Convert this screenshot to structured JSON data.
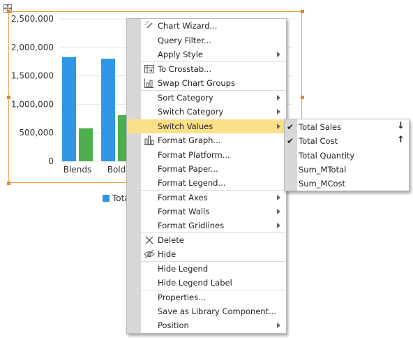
{
  "chart_data": {
    "type": "bar",
    "categories": [
      "Blends",
      "Bold"
    ],
    "series": [
      {
        "name": "Total Sales",
        "values": [
          1830000,
          1800000
        ],
        "color": "#2f96e8"
      },
      {
        "name": "Total Cost",
        "values": [
          580000,
          810000
        ],
        "color": "#4caf50"
      }
    ],
    "ylim": [
      0,
      2500000
    ],
    "yticks": [
      "2,500,000",
      "2,000,000",
      "1,500,000",
      "1,000,000",
      "500,000",
      "0"
    ],
    "grid": true
  },
  "legend": {
    "visible_text": "Tota",
    "color": "#2f96e8"
  },
  "context_menu": {
    "items": [
      {
        "label": "Chart Wizard...",
        "icon": "chart-wizard-icon",
        "submenu": false
      },
      {
        "label": "Query Filter...",
        "icon": "",
        "submenu": false
      },
      {
        "label": "Apply Style",
        "icon": "",
        "submenu": true
      },
      {
        "label": "To Crosstab...",
        "icon": "crosstab-icon",
        "submenu": false
      },
      {
        "label": "Swap Chart Groups",
        "icon": "swap-groups-icon",
        "submenu": false
      },
      {
        "label": "Sort Category",
        "icon": "",
        "submenu": true
      },
      {
        "label": "Switch Category",
        "icon": "",
        "submenu": true
      },
      {
        "label": "Switch Values",
        "icon": "",
        "submenu": true,
        "highlighted": true
      },
      {
        "label": "Format Graph...",
        "icon": "format-graph-icon",
        "submenu": false
      },
      {
        "label": "Format Platform...",
        "icon": "",
        "submenu": false
      },
      {
        "label": "Format Paper...",
        "icon": "",
        "submenu": false
      },
      {
        "label": "Format Legend...",
        "icon": "",
        "submenu": false
      },
      {
        "label": "Format Axes",
        "icon": "",
        "submenu": true
      },
      {
        "label": "Format Walls",
        "icon": "",
        "submenu": true
      },
      {
        "label": "Format Gridlines",
        "icon": "",
        "submenu": true
      },
      {
        "label": "Delete",
        "icon": "delete-icon",
        "submenu": false
      },
      {
        "label": "Hide",
        "icon": "hide-icon",
        "submenu": false
      },
      {
        "label": "Hide Legend",
        "icon": "",
        "submenu": false
      },
      {
        "label": "Hide Legend Label",
        "icon": "",
        "submenu": false
      },
      {
        "label": "Properties...",
        "icon": "",
        "submenu": false
      },
      {
        "label": "Save as Library Component...",
        "icon": "",
        "submenu": false
      },
      {
        "label": "Position",
        "icon": "",
        "submenu": true
      }
    ]
  },
  "submenu": {
    "items": [
      {
        "label": "Total Sales",
        "checked": true,
        "sort": "↓"
      },
      {
        "label": "Total Cost",
        "checked": true,
        "sort": "↑"
      },
      {
        "label": "Total Quantity",
        "checked": false,
        "sort": ""
      },
      {
        "label": "Sum_MTotal",
        "checked": false,
        "sort": ""
      },
      {
        "label": "Sum_MCost",
        "checked": false,
        "sort": ""
      }
    ]
  }
}
